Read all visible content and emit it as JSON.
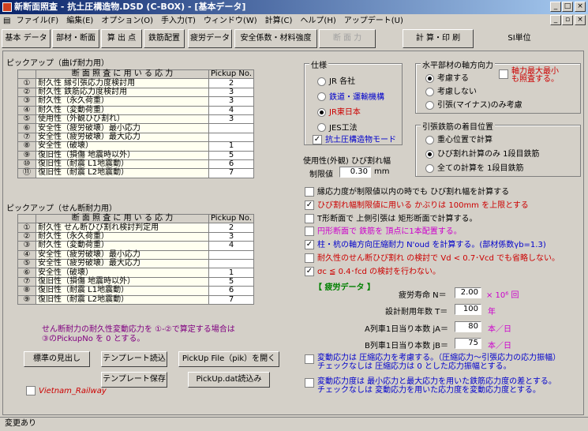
{
  "window": {
    "title": "新断面照査 - 抗土圧構造物.DSD (C-BOX) - [基本データ]"
  },
  "menu": [
    "ファイル(F)",
    "編集(E)",
    "オプション(O)",
    "手入力(T)",
    "ウィンドウ(W)",
    "計算(C)",
    "ヘルプ(H)",
    "アップデート(U)"
  ],
  "tabs": [
    "基本 データ",
    "部材・断面",
    "算 出 点",
    "鉄筋配置",
    "疲労データ",
    "安全係数・材料強度",
    "断 面 力",
    "計 算・印 刷",
    "SI単位"
  ],
  "pickup_bending": {
    "label": "ピックアップ（曲げ耐力用）",
    "header": {
      "col": "断 面 照 査 に 用 い る 応 力",
      "val": "Pickup No."
    },
    "rows": [
      {
        "n": "①",
        "t": "耐久性 縁引張応力度検討用",
        "v": "2"
      },
      {
        "n": "②",
        "t": "耐久性 鉄筋応力度検討用",
        "v": "3"
      },
      {
        "n": "③",
        "t": "耐久性（永久荷重）",
        "v": "3"
      },
      {
        "n": "④",
        "t": "耐久性（変動荷重）",
        "v": "4"
      },
      {
        "n": "⑤",
        "t": "使用性（外観ひび割れ）",
        "v": "3"
      },
      {
        "n": "⑥",
        "t": "安全性（疲労破壊）最小応力",
        "v": ""
      },
      {
        "n": "⑦",
        "t": "安全性（疲労破壊）最大応力",
        "v": ""
      },
      {
        "n": "⑧",
        "t": "安全性（破壊）",
        "v": "1"
      },
      {
        "n": "⑨",
        "t": "復旧性（損傷 地震時以外）",
        "v": "5"
      },
      {
        "n": "⑩",
        "t": "復旧性（耐震 L1地震動）",
        "v": "6"
      },
      {
        "n": "⑪",
        "t": "復旧性（耐震 L2地震動）",
        "v": "7"
      }
    ]
  },
  "pickup_shear": {
    "label": "ピックアップ（せん断耐力用）",
    "header": {
      "col": "断 面 照 査 に 用 い る 応 力",
      "val": "Pickup No."
    },
    "rows": [
      {
        "n": "①",
        "t": "耐久性 せん断ひび割れ検討判定用",
        "v": "2"
      },
      {
        "n": "②",
        "t": "耐久性（永久荷重）",
        "v": "3"
      },
      {
        "n": "③",
        "t": "耐久性（変動荷重）",
        "v": "4"
      },
      {
        "n": "④",
        "t": "安全性（疲労破壊）最小応力",
        "v": ""
      },
      {
        "n": "⑤",
        "t": "安全性（疲労破壊）最大応力",
        "v": ""
      },
      {
        "n": "⑥",
        "t": "安全性（破壊）",
        "v": "1"
      },
      {
        "n": "⑦",
        "t": "復旧性（損傷 地震時以外）",
        "v": "5"
      },
      {
        "n": "⑧",
        "t": "復旧性（耐震 L1地震動）",
        "v": "6"
      },
      {
        "n": "⑨",
        "t": "復旧性（耐震 L2地震動）",
        "v": "7"
      }
    ]
  },
  "note": "せん断耐力の耐久性変動応力を ①-②で算定する場合は\n③のPickupNo を 0 とする。",
  "buttons": {
    "standard": "標準の見出し",
    "template_load": "テンプレート読込",
    "pickup_open": "PickUp File（pik）を開く",
    "template_save": "テンプレート保存",
    "pickup_dat": "PickUp.dat読込み"
  },
  "vietnam": {
    "label": "Vietnam_Railway",
    "checked": false
  },
  "spec": {
    "title": "仕様",
    "options": [
      "JR 各社",
      "鉄道・運輸機構",
      "JR東日本",
      "JES工法"
    ],
    "selected": 2,
    "earth_pressure_mode": {
      "label": "抗土圧構造物モード",
      "checked": true
    }
  },
  "axial": {
    "title": "水平部材の軸方向力",
    "options": [
      "考慮する",
      "考慮しない",
      "引張(マイナス)のみ考慮"
    ],
    "selected": 0,
    "max_label": "軸力最大最小\nも照査する。"
  },
  "rebar": {
    "title": "引張鉄筋の着目位置",
    "options": [
      "重心位置で計算",
      "ひび割れ計算のみ 1段目鉄筋",
      "全ての計算を 1段目鉄筋"
    ],
    "selected": 1
  },
  "crack": {
    "label": "使用性(外観) ひび割れ幅",
    "limit_label": "制限値",
    "value": "0.30",
    "unit": "mm"
  },
  "checks": [
    {
      "t": "縁応力度が制限値以内の時でも ひび割れ幅を計算する",
      "c": false,
      "color": "#000000"
    },
    {
      "t": "ひび割れ幅制限値に用いる かぶりは 100mm を上限とする",
      "c": true,
      "color": "#cc0000"
    },
    {
      "t": "T形断面で 上側引張は 矩形断面で計算する。",
      "c": false,
      "color": "#000000"
    },
    {
      "t": "円形断面で 鉄筋を 頂点に1本配置する。",
      "c": false,
      "color": "#cc00cc"
    },
    {
      "t": "柱・杭の軸方向圧縮耐力 N'oud を計算する。(部材係数γb=1.3)",
      "c": true,
      "color": "#0000cc"
    },
    {
      "t": "耐久性のせん断ひび割れ の検討で Vd < 0.7･Vcd でも省略しない。",
      "c": false,
      "color": "#cc0000"
    },
    {
      "t": "σc ≦ 0.4･fcd の検討を行わない。",
      "c": true,
      "color": "#cc0000"
    }
  ],
  "fatigue": {
    "title": "【 疲労データ 】",
    "life": {
      "label": "疲労寿命 N＝",
      "value": "2.00",
      "unit": "× 10⁶ 回"
    },
    "years": {
      "label": "設計耐用年数 T＝",
      "value": "100",
      "unit": "年"
    },
    "ja": {
      "label": "A列車1日当り本数 jA＝",
      "value": "80",
      "unit": "本／日"
    },
    "jb": {
      "label": "B列車1日当り本数 jB＝",
      "value": "75",
      "unit": "本／日"
    }
  },
  "fatigue_checks": [
    {
      "t": "変動応力は 圧縮応力を考慮する。（圧縮応力～引張応力の応力振幅）\nチェックなしは 圧縮応力は 0 とした応力振幅とする。",
      "c": false
    },
    {
      "t": "変動応力度は 最小応力と最大応力を用いた鉄筋応力度の差とする。\nチェックなしは 変動応力を用いた応力度を変動応力度とする。",
      "c": false
    }
  ],
  "status": "変更あり"
}
